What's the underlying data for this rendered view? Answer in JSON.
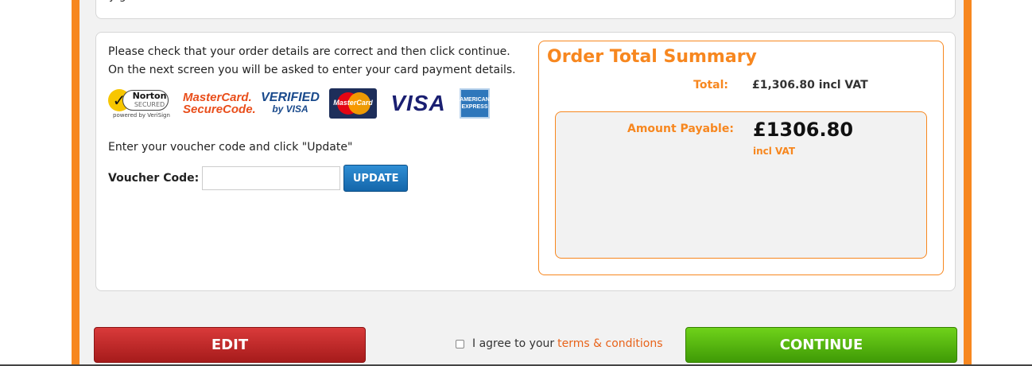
{
  "top_panel": {
    "partial_text": "y                    g"
  },
  "instructions": {
    "line1": "Please check that your order details are correct and then click continue.",
    "line2": "On the next screen you will be asked to enter your card payment details."
  },
  "logos": {
    "norton": {
      "brand": "Norton",
      "secured": "SECURED",
      "sub": "powered by VeriSign"
    },
    "mastercard_securecode": {
      "line1": "MasterCard.",
      "line2": "SecureCode."
    },
    "verified_by_visa": {
      "line1": "VERIFIED",
      "line2": "by VISA"
    },
    "mastercard": "MasterCard",
    "visa": "VISA",
    "amex": {
      "line1": "AMERICAN",
      "line2": "EXPRESS"
    }
  },
  "voucher": {
    "help": "Enter your voucher code and click \"Update\"",
    "label": "Voucher Code:",
    "value": "",
    "button": "UPDATE"
  },
  "summary": {
    "title": "Order Total Summary",
    "total_label": "Total:",
    "total_value": "£1,306.80 incl VAT",
    "payable_label": "Amount Payable:",
    "payable_amount": "£1306.80",
    "payable_vat": "incl VAT"
  },
  "footer": {
    "edit_button": "EDIT",
    "agree_text": "I agree to your",
    "terms_link": "terms & conditions",
    "continue_button": "CONTINUE"
  },
  "colors": {
    "accent": "#f7871f",
    "edit": "#b52222",
    "continue": "#52b30f",
    "update": "#1e78be",
    "link": "#e8631a"
  }
}
